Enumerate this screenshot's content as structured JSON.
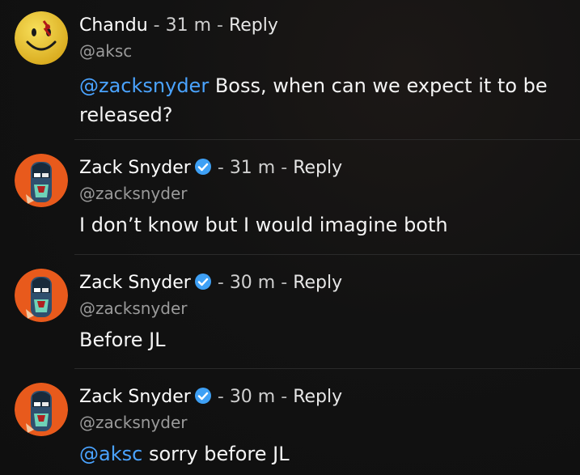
{
  "comments": [
    {
      "author": "Chandu",
      "handle": "@aksc",
      "time": "31 m",
      "separator": "-",
      "reply_label": "Reply",
      "verified": false,
      "mention": "@zacksnyder",
      "text_line1": " Boss, when can we expect it to be",
      "text_line2": "released?",
      "avatar_icon": "smiley-face-avatar"
    },
    {
      "author": "Zack Snyder",
      "handle": "@zacksnyder",
      "time": "31 m",
      "separator": "-",
      "reply_label": "Reply",
      "verified": true,
      "text": "I don’t know but I would imagine both",
      "avatar_icon": "comic-character-avatar"
    },
    {
      "author": "Zack Snyder",
      "handle": "@zacksnyder",
      "time": "30 m",
      "separator": "-",
      "reply_label": "Reply",
      "verified": true,
      "text": "Before JL",
      "avatar_icon": "comic-character-avatar"
    },
    {
      "author": "Zack Snyder",
      "handle": "@zacksnyder",
      "time": "30 m",
      "separator": "-",
      "reply_label": "Reply",
      "verified": true,
      "mention": "@aksc",
      "text": " sorry before JL",
      "avatar_icon": "comic-character-avatar"
    }
  ],
  "colors": {
    "background": "#121212",
    "mention": "#4aa3ff",
    "verified_badge": "#3ea0f5"
  }
}
